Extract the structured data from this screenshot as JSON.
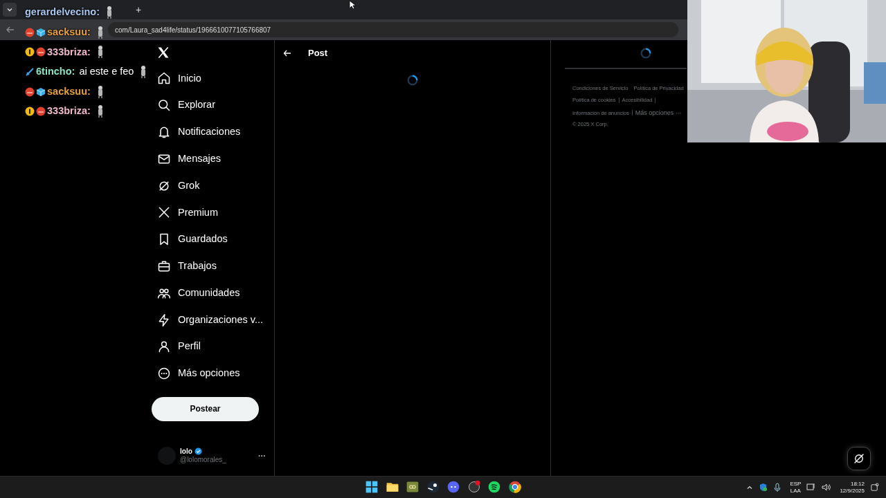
{
  "browser": {
    "tab_new": "+",
    "url": "com/Laura_sad4life/status/1966610077105766807"
  },
  "chat": [
    {
      "user": "gerardelvecino:",
      "color": "#a9c6ee"
    },
    {
      "user": "sacksuu:",
      "color": "#e8a03a",
      "badges": [
        {
          "kind": "round"
        },
        {
          "kind": "cube"
        }
      ]
    },
    {
      "user": "333briza:",
      "color": "#f0b8cc",
      "badges": [
        {
          "kind": "sub"
        },
        {
          "kind": "round"
        }
      ]
    },
    {
      "user": "6tincho:",
      "color": "#86e3c4",
      "badges": [
        {
          "kind": "sword"
        }
      ],
      "message": "ai este e feo"
    },
    {
      "user": "sacksuu:",
      "color": "#e8a03a",
      "badges": [
        {
          "kind": "round"
        },
        {
          "kind": "cube"
        }
      ]
    },
    {
      "user": "333briza:",
      "color": "#f0b8cc",
      "badges": [
        {
          "kind": "sub"
        },
        {
          "kind": "round"
        }
      ]
    }
  ],
  "sidebar": {
    "items": [
      {
        "label": "Inicio"
      },
      {
        "label": "Explorar"
      },
      {
        "label": "Notificaciones"
      },
      {
        "label": "Mensajes"
      },
      {
        "label": "Grok"
      },
      {
        "label": "Premium"
      },
      {
        "label": "Guardados"
      },
      {
        "label": "Trabajos"
      },
      {
        "label": "Comunidades"
      },
      {
        "label": "Organizaciones v..."
      },
      {
        "label": "Perfil"
      },
      {
        "label": "Más opciones"
      }
    ],
    "post_button": "Postear",
    "account": {
      "name": "lolo",
      "handle": "@lolomorales_",
      "more": "···"
    }
  },
  "main": {
    "title": "Post"
  },
  "footer": {
    "rows": [
      [
        "Condiciones de Servicio",
        "Política de Privacidad"
      ],
      [
        "Política de cookies",
        "Accesibilidad"
      ],
      [
        "Información de anuncios",
        "Más opciones ···"
      ]
    ],
    "copyright": "© 2025 X Corp."
  },
  "taskbar": {
    "language": "ESP",
    "layout": "LAA",
    "time": "18:12",
    "date": "12/9/2025"
  }
}
